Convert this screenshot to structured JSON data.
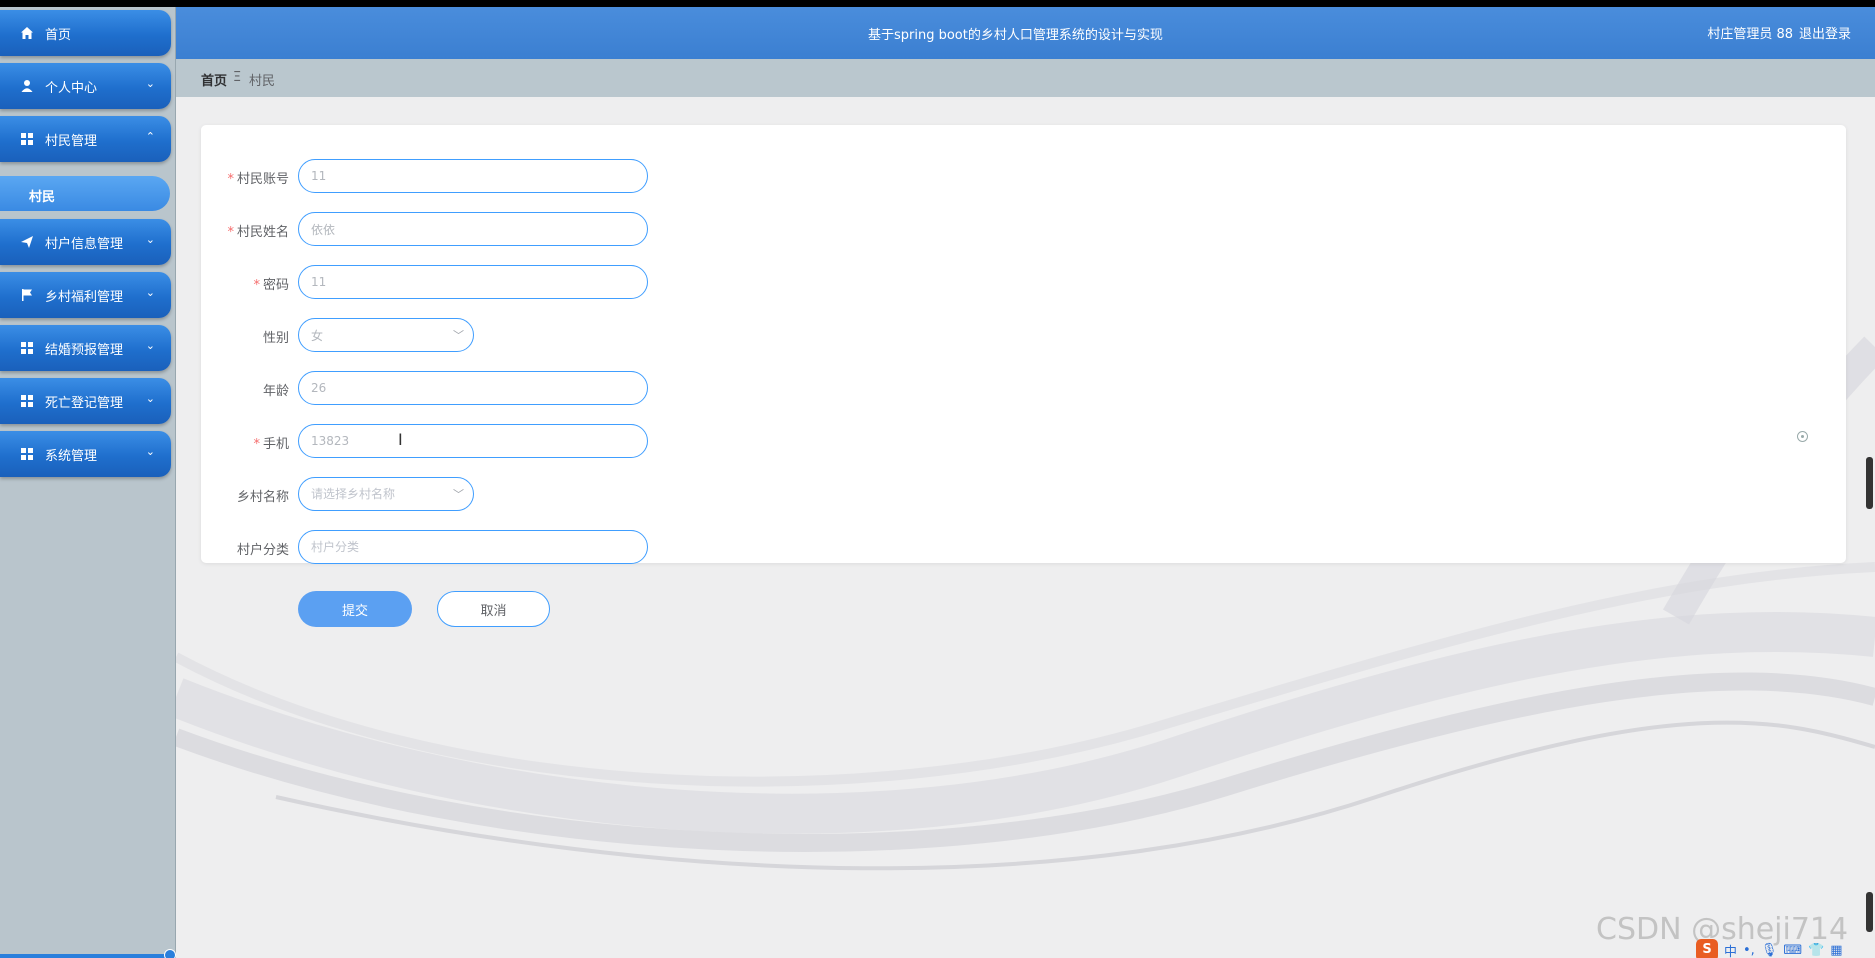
{
  "header": {
    "title": "基于spring boot的乡村人口管理系统的设计与实现",
    "user": "村庄管理员 88",
    "logout": "退出登录"
  },
  "breadcrumb": {
    "home": "首页",
    "separator": "Ξ",
    "current": "村民"
  },
  "sidebar": {
    "items": [
      {
        "label": "首页",
        "icon": "home-icon"
      },
      {
        "label": "个人中心",
        "icon": "user-icon",
        "arrow": "⌄"
      },
      {
        "label": "村民管理",
        "icon": "grid-icon",
        "arrow": "⌃"
      },
      {
        "label": "村户信息管理",
        "icon": "send-icon",
        "arrow": "⌄"
      },
      {
        "label": "乡村福利管理",
        "icon": "flag-icon",
        "arrow": "⌄"
      },
      {
        "label": "结婚预报管理",
        "icon": "grid-icon",
        "arrow": "⌄"
      },
      {
        "label": "死亡登记管理",
        "icon": "grid-icon",
        "arrow": "⌄"
      },
      {
        "label": "系统管理",
        "icon": "grid-icon",
        "arrow": "⌄"
      }
    ],
    "subitem": "村民"
  },
  "form": {
    "account": {
      "label": "村民账号",
      "value": "11"
    },
    "name": {
      "label": "村民姓名",
      "value": "依依"
    },
    "password": {
      "label": "密码",
      "value": "11"
    },
    "gender": {
      "label": "性别",
      "value": "女"
    },
    "age": {
      "label": "年龄",
      "value": "26"
    },
    "phone": {
      "label": "手机",
      "value": "13823"
    },
    "village": {
      "label": "乡村名称",
      "placeholder": "请选择乡村名称"
    },
    "category": {
      "label": "村户分类",
      "placeholder": "村户分类"
    },
    "required_mark": "*",
    "submit": "提交",
    "cancel": "取消"
  },
  "watermark": "CSDN @sheji714",
  "tray": {
    "ime": "S",
    "ime_mode": "中"
  },
  "colors": {
    "header": "#3b7fd1",
    "menu": "#1f6fcd",
    "accent": "#409eff",
    "submit": "#5ba0f2",
    "required": "#f56c6c"
  }
}
